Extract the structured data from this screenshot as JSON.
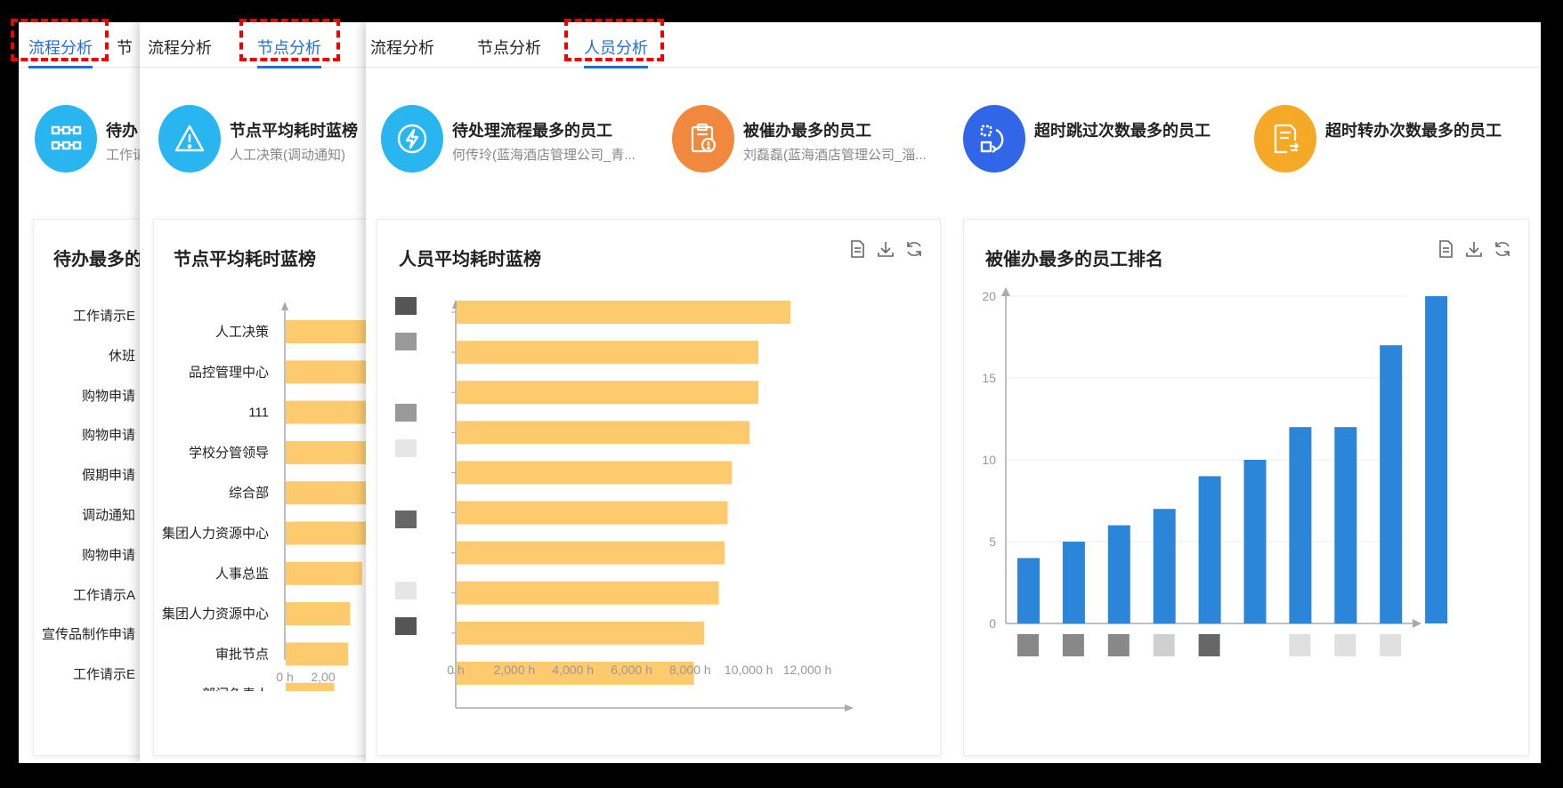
{
  "colors": {
    "accent": "#1f6fd8",
    "bar_orange": "#fdcb6e",
    "bar_blue": "#2b86d9",
    "cyan": "#29b6f0",
    "orange": "#f0883e",
    "blue": "#3166e8",
    "yellow": "#f5a927"
  },
  "panel1": {
    "tabs": [
      "流程分析",
      "节"
    ],
    "stat": {
      "title": "待办",
      "sub": "工作请"
    },
    "card_title": "待办最多的",
    "rows": [
      "工作请示E",
      "休班",
      "购物申请",
      "购物申请",
      "假期申请",
      "调动通知",
      "购物申请",
      "工作请示A",
      "宣传品制作申请",
      "工作请示E"
    ]
  },
  "panel2": {
    "tabs": [
      "流程分析",
      "节点分析"
    ],
    "stat": {
      "title": "节点平均耗时蓝榜",
      "sub": "人工决策(调动通知)"
    },
    "chart_data": {
      "type": "bar",
      "title": "节点平均耗时蓝榜",
      "categories": [
        "人工决策",
        "品控管理中心",
        "111",
        "学校分管领导",
        "综合部",
        "集团人力资源中心",
        "人事总监",
        "集团人力资源中心",
        "审批节点",
        "部门负责人"
      ],
      "values": [
        null,
        null,
        null,
        1400,
        1370,
        1200,
        1100,
        930,
        900,
        700
      ],
      "xticks": [
        "0 h",
        "2,00"
      ]
    }
  },
  "panel3": {
    "tabs": [
      "流程分析",
      "节点分析",
      "人员分析"
    ],
    "stats": [
      {
        "title": "待处理流程最多的员工",
        "sub": "何传玲(蓝海酒店管理公司_青...",
        "icon": "lightning-icon"
      },
      {
        "title": "被催办最多的员工",
        "sub": "刘磊磊(蓝海酒店管理公司_淄...",
        "icon": "clipboard-alert-icon"
      },
      {
        "title": "超时跳过次数最多的员工",
        "sub": "",
        "icon": "skip-flow-icon"
      },
      {
        "title": "超时转办次数最多的员工",
        "sub": "",
        "icon": "document-transfer-icon"
      }
    ],
    "chart1": {
      "type": "bar",
      "title": "人员平均耗时蓝榜",
      "values": [
        11400,
        10300,
        10300,
        10000,
        9400,
        9250,
        9150,
        8950,
        8450,
        8100
      ],
      "xlim": [
        0,
        12000
      ],
      "xticks": [
        "0 h",
        "2,000 h",
        "4,000 h",
        "6,000 h",
        "8,000 h",
        "10,000 h",
        "12,000 h"
      ]
    },
    "chart2": {
      "type": "bar",
      "title": "被催办最多的员工排名",
      "values": [
        4,
        5,
        6,
        7,
        9,
        10,
        12,
        12,
        17,
        20
      ],
      "ylim": [
        0,
        20
      ],
      "yticks": [
        "0",
        "5",
        "10",
        "15",
        "20"
      ]
    }
  }
}
